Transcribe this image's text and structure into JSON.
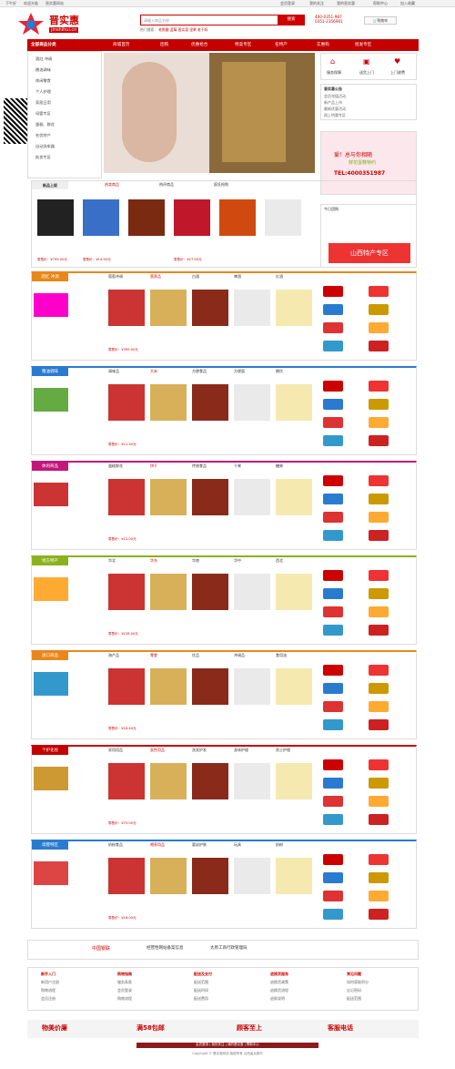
{
  "topbar": {
    "left1": "下午好",
    "left2": "欢迎光临",
    "left3": "晋实惠网站",
    "links": [
      "会员登录",
      "我的关注",
      "我的晋实惠",
      "帮助中心",
      "加入收藏"
    ]
  },
  "header": {
    "logo_text": "晋实惠",
    "logo_sub": "jinshihui.cn",
    "search_placeholder": "请输入商品名称",
    "search_btn": "搜索",
    "hot_words": [
      "热门搜索：",
      "老陈醋",
      "蓝莓",
      "晋实惠",
      "坚果",
      "老干妈"
    ],
    "phone1": "400-0351-987",
    "phone2": "0351-2356901",
    "cart": "购物车"
  },
  "nav": {
    "all": "全部商品分类",
    "items": [
      "商城首页",
      "团购",
      "优惠抢合",
      "特卖专区",
      "名特产",
      "实惠购",
      "批发专区"
    ]
  },
  "cats": [
    "酒红 冲调",
    "粮油调味",
    "休闲零食",
    "个人护理",
    "家居日用",
    "母婴专区",
    "蛋糕、鲜花",
    "名优特产",
    "自动洗车器",
    "批发专区"
  ],
  "side": {
    "icons": [
      "服务保障",
      "送货上门",
      "上门收费"
    ],
    "news_title": "晋实惠公告",
    "news": [
      "会员充值活动",
      "新产品上市",
      "最新优惠活动",
      "网上特惠专区"
    ],
    "ad1": "爱！总与你相随",
    "ad2": "鲜花蛋糕特约",
    "ad3": "TEL:4000351987",
    "ad_title": "今日团购",
    "tuan": "山西特产专区"
  },
  "tabs1": [
    "新品上架",
    "热卖商品",
    "热评商品",
    "疯狂抢购"
  ],
  "rows": [
    {
      "title": "酒红 冲调",
      "color": "#e8881a",
      "tabs": [
        "葡萄冲调",
        "营养品",
        "白酒",
        "啤酒",
        "红酒"
      ]
    },
    {
      "title": "粮油调味",
      "color": "#2a7bd0",
      "tabs": [
        "调味品",
        "大米",
        "方便食品",
        "方便面",
        "粮饮"
      ]
    },
    {
      "title": "休闲商品",
      "color": "#c2187a",
      "tabs": [
        "蛋糕鲜花",
        "饼干",
        "传统食品",
        "干果",
        "糖果"
      ]
    },
    {
      "title": "地方特产",
      "color": "#8ab21c",
      "tabs": [
        "华北",
        "华东",
        "华南",
        "华中",
        "西北"
      ]
    },
    {
      "title": "进口商品",
      "color": "#e8881a",
      "tabs": [
        "海产品",
        "零食",
        "饮品",
        "冲调品",
        "食用油"
      ]
    },
    {
      "title": "个护化妆",
      "color": "#c40000",
      "tabs": [
        "家用用品",
        "女性用品",
        "洗发护发",
        "身体护理",
        "男士护理"
      ]
    },
    {
      "title": "母婴特区",
      "color": "#2a7bd0",
      "tabs": [
        "奶粉食品",
        "喂养用品",
        "婴幼护肤",
        "玩具",
        "奶粉"
      ]
    }
  ],
  "prices": [
    "零售价：¥799.00元",
    "零售价：¥14.90元",
    "零售价：¥27.00元",
    "零售价：¥399.00元",
    "零售价：¥11.50元",
    "零售价：¥12.00元",
    "零售价：¥228.00元",
    "零售价：¥18.40元",
    "零售价：¥75.00元",
    "零售价：¥16.00元",
    "零售价：¥184.00元"
  ],
  "footer": {
    "pay": [
      "中国银联",
      "经营性网站备案信息",
      "太原工商行政管理局"
    ],
    "cols": [
      {
        "t": "新手入门",
        "i": [
          "新用户注册",
          "购物流程",
          "会员注册"
        ]
      },
      {
        "t": "购物指南",
        "i": [
          "服务条款",
          "会员登录",
          "购物流程"
        ]
      },
      {
        "t": "配送及支付",
        "i": [
          "配送范围",
          "配送时间",
          "配送费用"
        ]
      },
      {
        "t": "退换货服务",
        "i": [
          "退换货政策",
          "退换货流程",
          "退款说明"
        ]
      },
      {
        "t": "常见问题",
        "i": [
          "如何获取积分",
          "忘记密码",
          "配送范围"
        ]
      }
    ],
    "banner": [
      "物美价廉",
      "满58包邮",
      "顾客至上",
      "客服电话"
    ],
    "copy": "Copyright © 晋实惠网站 版权所有  山西省太原市",
    "links": [
      "会员登录",
      "我的关注",
      "我的晋实惠",
      "帮助中心"
    ]
  }
}
